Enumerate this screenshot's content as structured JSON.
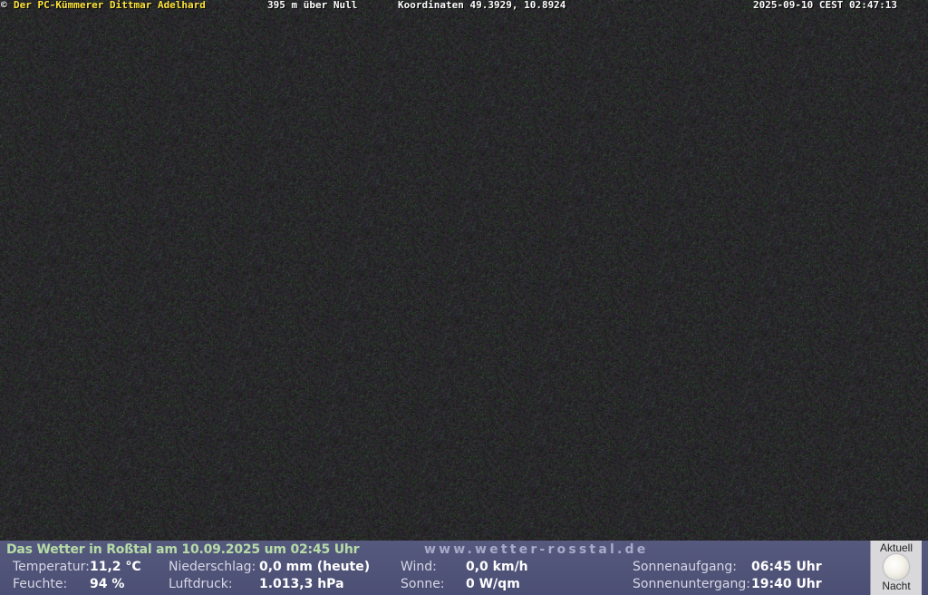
{
  "overlay": {
    "copyright_symbol": "©",
    "owner": "Der PC-Kümmerer Dittmar Adelhard",
    "altitude": "395 m über Null",
    "coordinates": "Koordinaten 49.3929, 10.8924",
    "timestamp": "2025-09-10 CEST 02:47:13"
  },
  "weather": {
    "headline": "Das Wetter in Roßtal am 10.09.2025 um 02:45 Uhr",
    "website": "www.wetter-rosstal.de",
    "temperature_label": "Temperatur:",
    "temperature_value": "11,2 °C",
    "humidity_label": "Feuchte:",
    "humidity_value": "94 %",
    "precipitation_label": "Niederschlag:",
    "precipitation_value": "0,0 mm (heute)",
    "pressure_label": "Luftdruck:",
    "pressure_value": "1.013,3 hPa",
    "wind_label": "Wind:",
    "wind_value": "0,0 km/h",
    "sun_label": "Sonne:",
    "sun_value": "0 W/qm",
    "sunrise_label": "Sonnenaufgang:",
    "sunrise_value": "06:45 Uhr",
    "sunset_label": "Sonnenuntergang:",
    "sunset_value": "19:40 Uhr"
  },
  "moon": {
    "top_label": "Aktuell",
    "bottom_label": "Nacht",
    "icon": "moon-icon"
  },
  "colors": {
    "owner_text": "#ffe53b",
    "panel_background": "#56597e",
    "headline_text": "#b6dca6"
  }
}
